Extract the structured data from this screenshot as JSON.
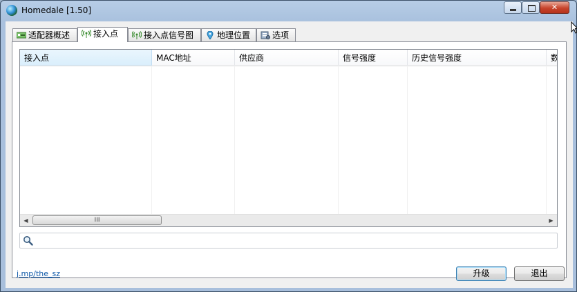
{
  "window": {
    "title": "Homedale [1.50]",
    "close_glyph": "✕"
  },
  "tabs": [
    {
      "label": "适配器概述",
      "icon": "network-adapter-icon",
      "active": false
    },
    {
      "label": "接入点",
      "icon": "wifi-signal-icon",
      "active": true
    },
    {
      "label": "接入点信号图",
      "icon": "wifi-signal-icon",
      "active": false
    },
    {
      "label": "地理位置",
      "icon": "location-pin-icon",
      "active": false
    },
    {
      "label": "选项",
      "icon": "options-icon",
      "active": false
    }
  ],
  "table": {
    "columns": [
      "接入点",
      "MAC地址",
      "供应商",
      "信号强度",
      "历史信号强度",
      "数"
    ],
    "sort_arrow": "^",
    "rows": []
  },
  "scrollbar": {
    "left_arrow": "◀",
    "right_arrow": "▶",
    "grip": "III"
  },
  "search": {
    "value": "",
    "placeholder": ""
  },
  "footer": {
    "link": "j.mp/the_sz",
    "upgrade_label": "升级",
    "exit_label": "退出"
  },
  "colors": {
    "title_bar": "#b7cde6",
    "close_button": "#c7432b",
    "link": "#0b57a8"
  }
}
